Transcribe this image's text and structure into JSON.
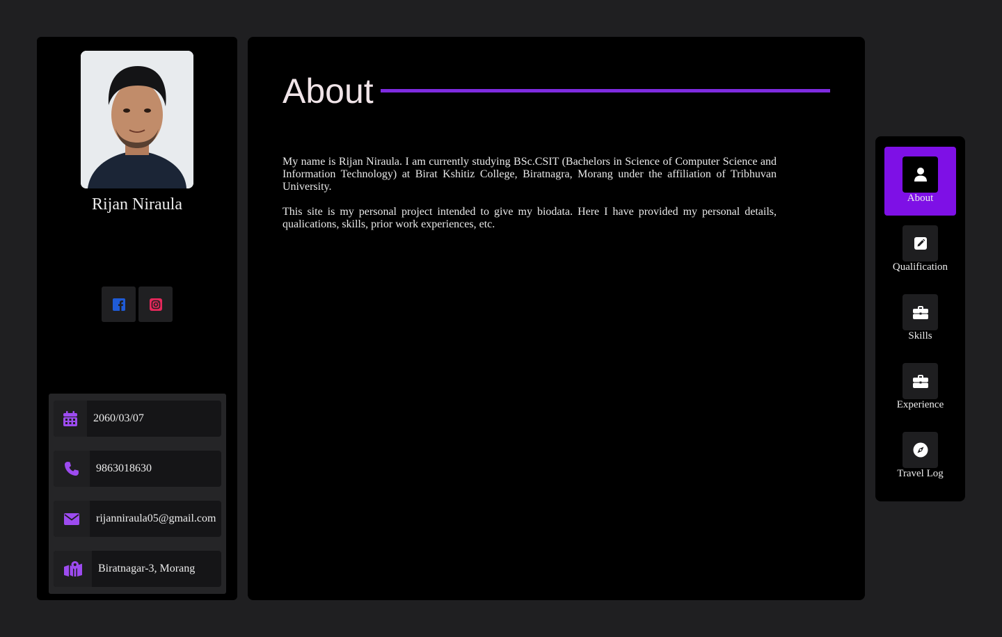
{
  "profile": {
    "name": "Rijan Niraula",
    "socials": [
      {
        "icon": "facebook-icon",
        "color": "#1f5bd6"
      },
      {
        "icon": "instagram-icon",
        "color": "#e5285b"
      }
    ],
    "info": [
      {
        "icon": "calendar-icon",
        "text": "2060/03/07"
      },
      {
        "icon": "phone-icon",
        "text": "9863018630"
      },
      {
        "icon": "envelope-icon",
        "text": "rijanniraula05@gmail.com"
      },
      {
        "icon": "map-location-icon",
        "text": "Biratnagar-3, Morang"
      }
    ]
  },
  "main": {
    "title": "About",
    "paragraphs": [
      "My name is Rijan Niraula. I am currently studying BSc.CSIT (Bachelors in Science of Computer Science and Information Technology) at Birat Kshitiz College, Biratnagra, Morang under the affiliation of Tribhuvan University.",
      "This site is my personal project intended to give my biodata. Here I have provided my personal details, qualications, skills, prior work experiences, etc."
    ]
  },
  "nav": {
    "items": [
      {
        "label": "About",
        "icon": "user-icon",
        "active": true
      },
      {
        "label": "Qualification",
        "icon": "edit-icon",
        "active": false
      },
      {
        "label": "Skills",
        "icon": "briefcase-icon",
        "active": false
      },
      {
        "label": "Experience",
        "icon": "briefcase-icon",
        "active": false
      },
      {
        "label": "Travel Log",
        "icon": "compass-icon",
        "active": false
      }
    ]
  },
  "colors": {
    "accent": "#7e10e6",
    "icon_purple": "#9d4bf0",
    "background": "#1f1f21"
  }
}
